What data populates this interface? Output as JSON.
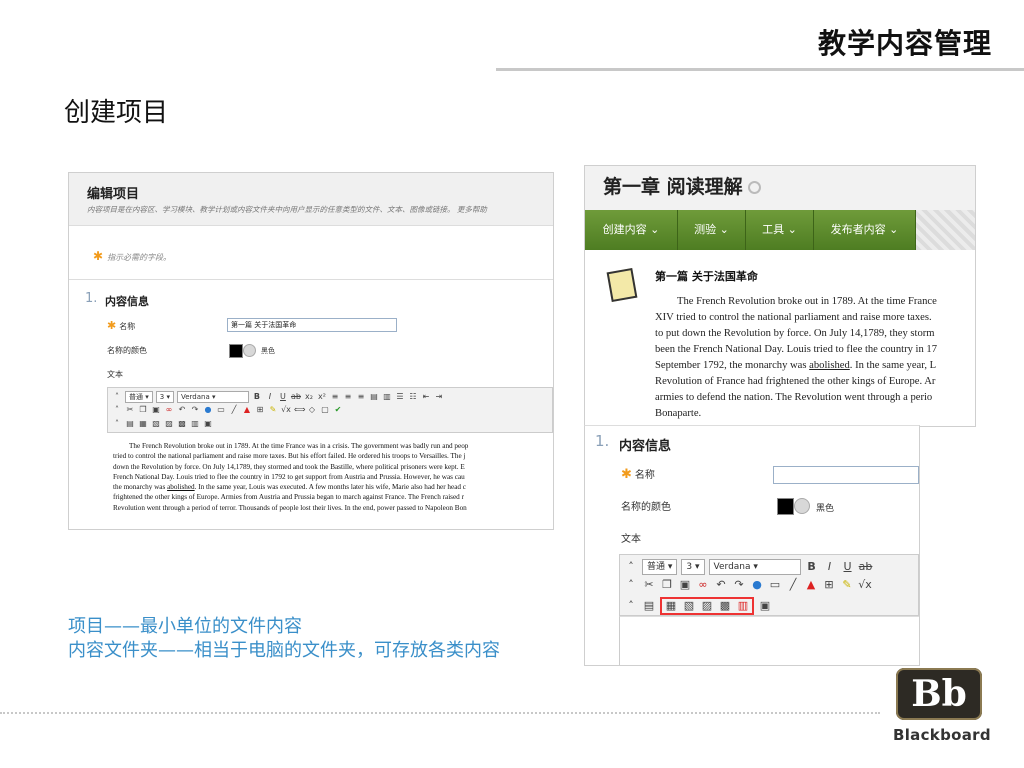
{
  "slide": {
    "title": "教学内容管理",
    "heading": "创建项目",
    "caption_line1": "项目——最小单位的文件内容",
    "caption_line2": "内容文件夹——相当于电脑的文件夹，可存放各类内容",
    "logo_mark": "Bb",
    "logo_text": "Blackboard"
  },
  "edit_item": {
    "title": "编辑项目",
    "description": "内容项目是在内容区、学习模块、教学计划或内容文件夹中向用户显示的任意类型的文件、文本、图像或链接。",
    "more_help": "更多帮助",
    "required_note": "指示必需的字段。",
    "section_number": "1.",
    "section_title": "内容信息",
    "name_label": "名称",
    "name_value": "第一篇 关于法国革命",
    "color_label": "名称的颜色",
    "color_value": "黑色",
    "text_label": "文本",
    "toolbar": {
      "format": "普通",
      "size": "3",
      "font": "Verdana"
    },
    "editor_lines": [
      "The French Revolution broke out in 1789. At the time France was in a crisis. The government was badly run and peop",
      "tried to control the national parliament and raise more taxes. But his effort failed. He ordered his troops to Versailles. The j",
      "down the Revolution by force. On July 14,1789, they stormed and took the Bastille, where political prisoners were kept. E",
      "French National Day. Louis tried to flee the country in 1792 to get support from Austria and Prussia. However, he was cau",
      "the monarchy was ",
      "abolished",
      ". In the same year, Louis was executed. A few months later his wife, Marie also had her head c",
      "frightened the other kings of Europe. Armies from Austria and Prussia began to march against France. The French raised r",
      "Revolution went through a period of terror. Thousands of people lost their lives. In the end, power passed to Napoleon Bon"
    ]
  },
  "chapter": {
    "title": "第一章 阅读理解",
    "nav": [
      "创建内容 ⌄",
      "测验 ⌄",
      "工具 ⌄",
      "发布者内容 ⌄"
    ],
    "item_title": "第一篇 关于法国革命",
    "item_lines": [
      "The French Revolution broke out in 1789. At the time France",
      "XIV tried to control the national parliament and raise more taxes.",
      "to put down the Revolution by force. On July 14,1789, they storm",
      "been the French National Day. Louis tried to flee the country in 17",
      "September 1792, the monarchy was ",
      "abolished",
      ". In the same year, L",
      "Revolution of France had frightened the other kings of Europe. Ar",
      "armies to defend the nation. The Revolution went through a perio",
      "Bonaparte."
    ]
  },
  "zoom_form": {
    "section_number": "1.",
    "section_title": "内容信息",
    "name_label": "名称",
    "color_label": "名称的颜色",
    "color_value": "黑色",
    "text_label": "文本",
    "toolbar": {
      "format": "普通",
      "size": "3",
      "font": "Verdana"
    }
  },
  "colors": {
    "accent_caption": "#3a8fc9",
    "nav_green": "#5a8a2c",
    "required_star": "#f29b1c",
    "highlight_box": "#e33333"
  }
}
